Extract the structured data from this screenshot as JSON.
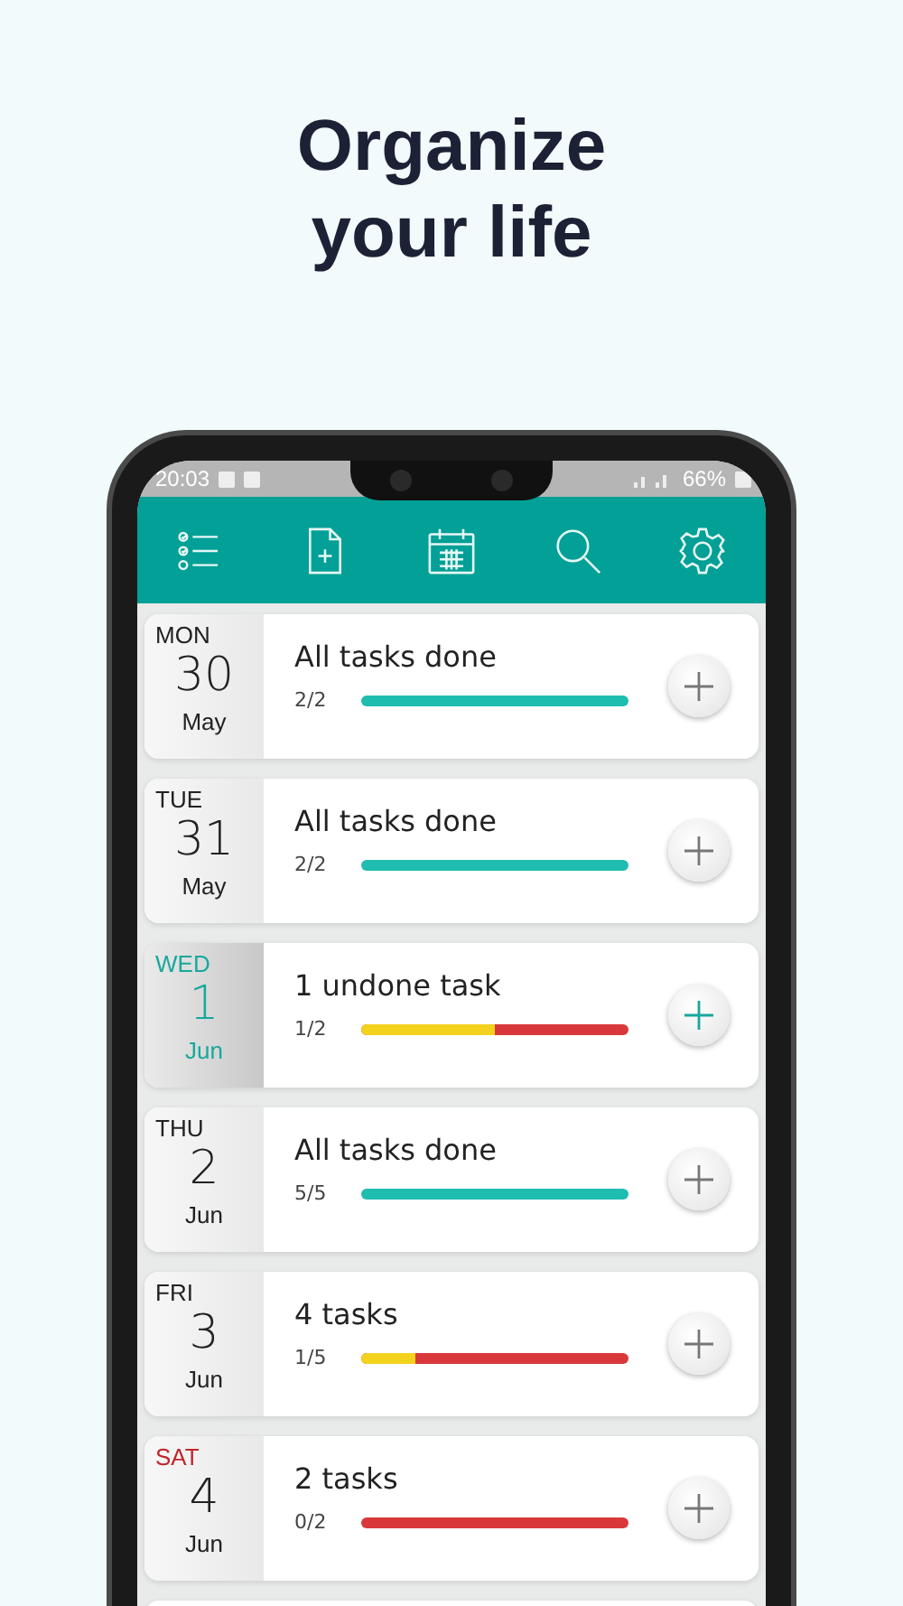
{
  "headline": [
    "Organize",
    "your life"
  ],
  "status_bar": {
    "time": "20:03",
    "battery": "66%"
  },
  "toolbar": [
    {
      "kind": "list"
    },
    {
      "kind": "new"
    },
    {
      "kind": "calendar"
    },
    {
      "kind": "search"
    },
    {
      "kind": "settings"
    }
  ],
  "days": [
    {
      "weekday": "MON",
      "date": "30",
      "month": "May",
      "summary": "All tasks done",
      "count": "2/2",
      "level": 1,
      "selected": false,
      "weekend": false
    },
    {
      "weekday": "TUE",
      "date": "31",
      "month": "May",
      "summary": "All tasks done",
      "count": "2/2",
      "level": 1,
      "selected": false,
      "weekend": false
    },
    {
      "weekday": "WED",
      "date": "1",
      "month": "Jun",
      "summary": "1 undone task",
      "count": "1/2",
      "level": 0.5,
      "selected": true,
      "weekend": false
    },
    {
      "weekday": "THU",
      "date": "2",
      "month": "Jun",
      "summary": "All tasks done",
      "count": "5/5",
      "level": 1,
      "selected": false,
      "weekend": false
    },
    {
      "weekday": "FRI",
      "date": "3",
      "month": "Jun",
      "summary": "4 tasks",
      "count": "1/5",
      "level": 0.2,
      "selected": false,
      "weekend": false
    },
    {
      "weekday": "SAT",
      "date": "4",
      "month": "Jun",
      "summary": "2 tasks",
      "count": "0/2",
      "level": 0,
      "selected": false,
      "weekend": true
    }
  ]
}
